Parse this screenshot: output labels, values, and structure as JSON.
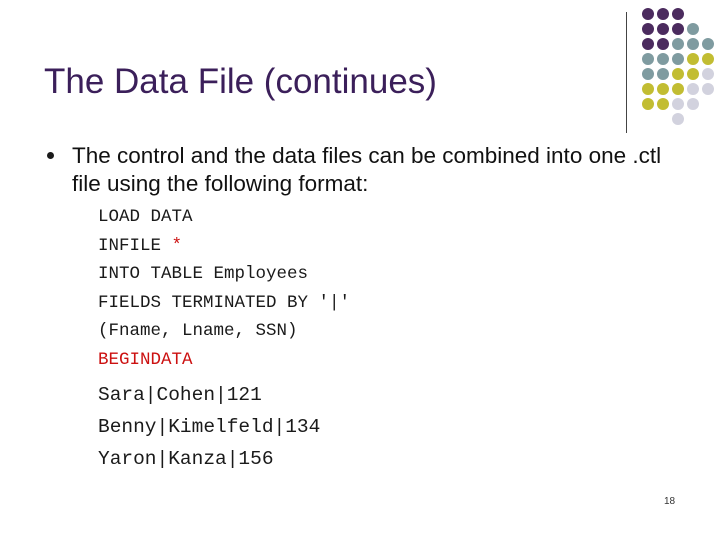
{
  "slide": {
    "title": "The Data File (continues)",
    "bullet": "The control and the data files can be combined into one .ctl file using the following format:",
    "code": {
      "line1": "LOAD DATA",
      "line2_prefix": "INFILE ",
      "line2_star": "*",
      "line3": "INTO TABLE Employees",
      "line4": "FIELDS TERMINATED BY '|'",
      "line5": "(Fname, Lname, SSN)",
      "line6": "BEGINDATA",
      "line7": "Sara|Cohen|121",
      "line8": "Benny|Kimelfeld|134",
      "line9": "Yaron|Kanza|156"
    },
    "page_number": "18"
  },
  "colors": {
    "title": "#3b1f5a",
    "highlight_red": "#cc1111",
    "dot_purple": "#4b2b5e",
    "dot_teal": "#7f9ba0",
    "dot_olive": "#c2bd32",
    "dot_light": "#d2d2de"
  }
}
